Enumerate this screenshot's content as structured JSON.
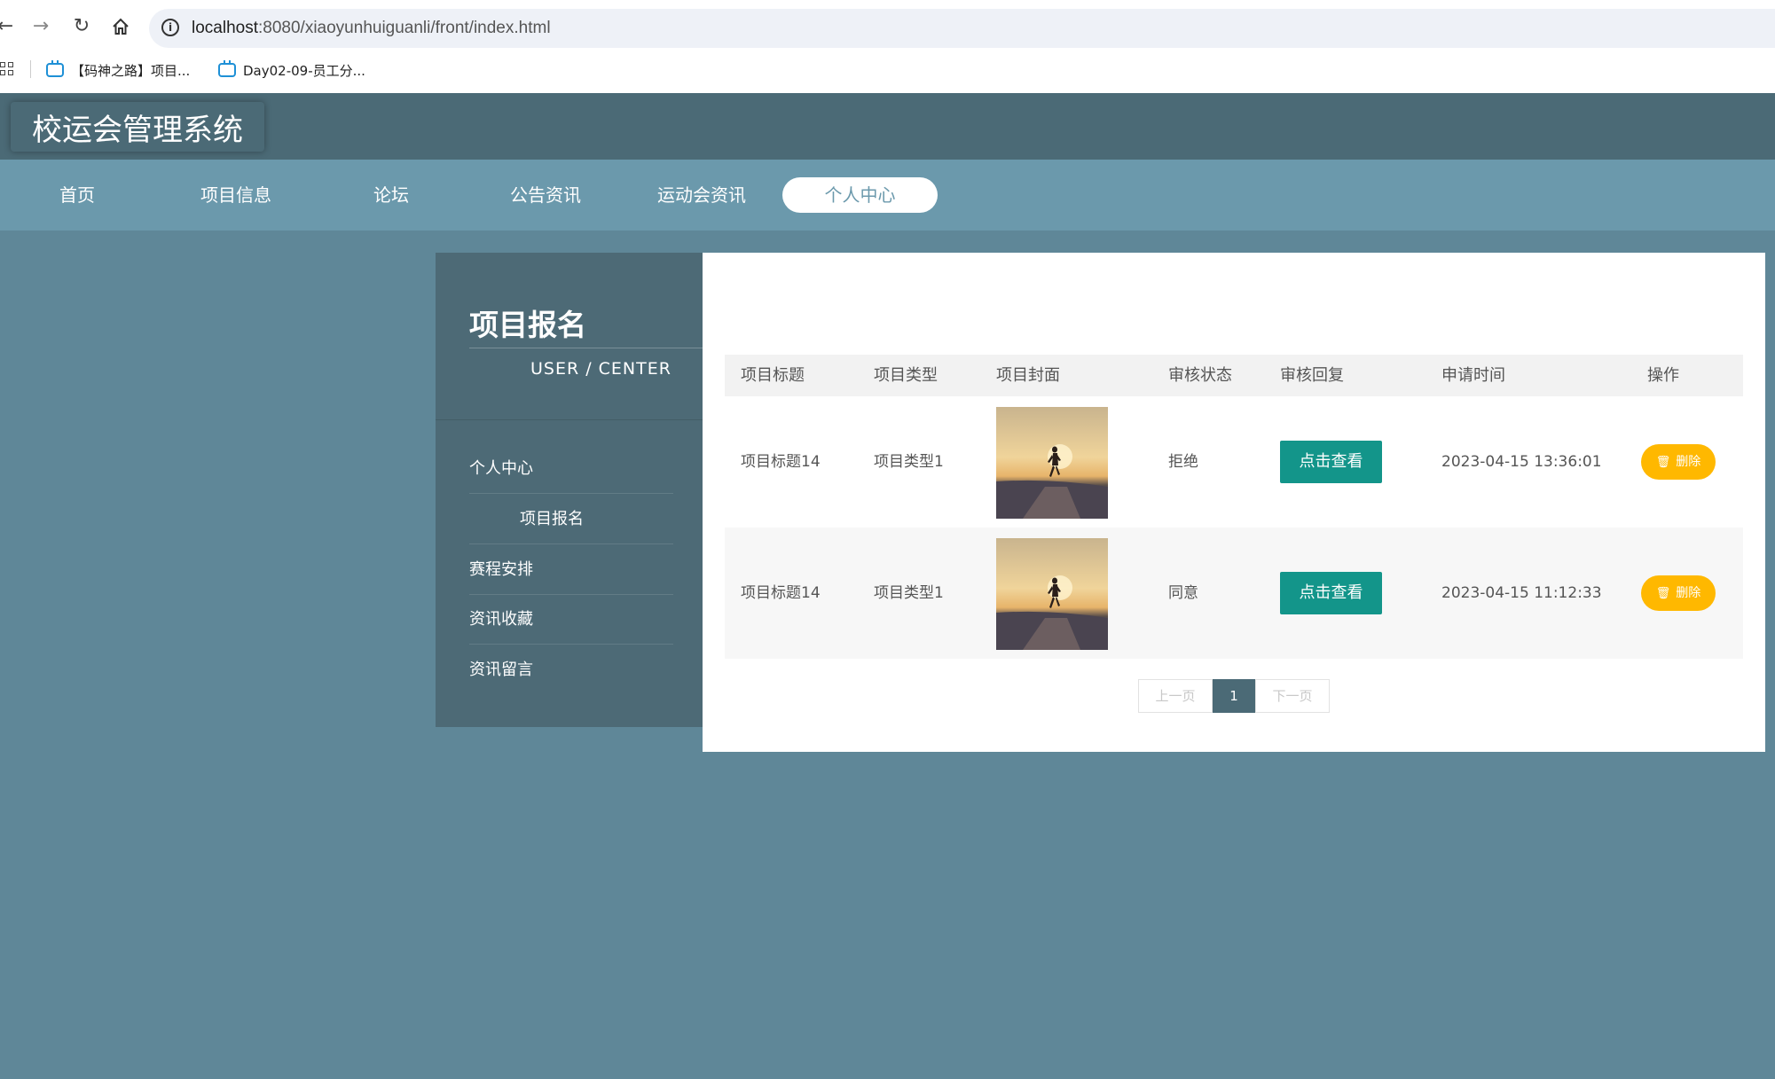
{
  "browser": {
    "url_host": "localhost",
    "url_path": ":8080/xiaoyunhuiguanli/front/index.html",
    "bookmarks": [
      "【码神之路】项目...",
      "Day02-09-员工分..."
    ]
  },
  "site": {
    "title": "校运会管理系统"
  },
  "nav": {
    "items": [
      "首页",
      "项目信息",
      "论坛",
      "公告资讯",
      "运动会资讯",
      "个人中心"
    ],
    "active": "个人中心"
  },
  "sidebar": {
    "title": "项目报名",
    "subtitle": "USER / CENTER",
    "items": [
      "个人中心",
      "项目报名",
      "赛程安排",
      "资讯收藏",
      "资讯留言"
    ]
  },
  "table": {
    "headers": [
      "项目标题",
      "项目类型",
      "项目封面",
      "审核状态",
      "审核回复",
      "申请时间",
      "操作"
    ],
    "rows": [
      {
        "title": "项目标题14",
        "type": "项目类型1",
        "status": "拒绝",
        "reply_button": "点击查看",
        "time": "2023-04-15 13:36:01",
        "delete_button": "删除"
      },
      {
        "title": "项目标题14",
        "type": "项目类型1",
        "status": "同意",
        "reply_button": "点击查看",
        "time": "2023-04-15 11:12:33",
        "delete_button": "删除"
      }
    ]
  },
  "pagination": {
    "prev": "上一页",
    "current": "1",
    "next": "下一页"
  },
  "colors": {
    "header": "#4b6a76",
    "nav": "#6b99ac",
    "view_button": "#13958a",
    "delete_button": "#ffb800"
  }
}
